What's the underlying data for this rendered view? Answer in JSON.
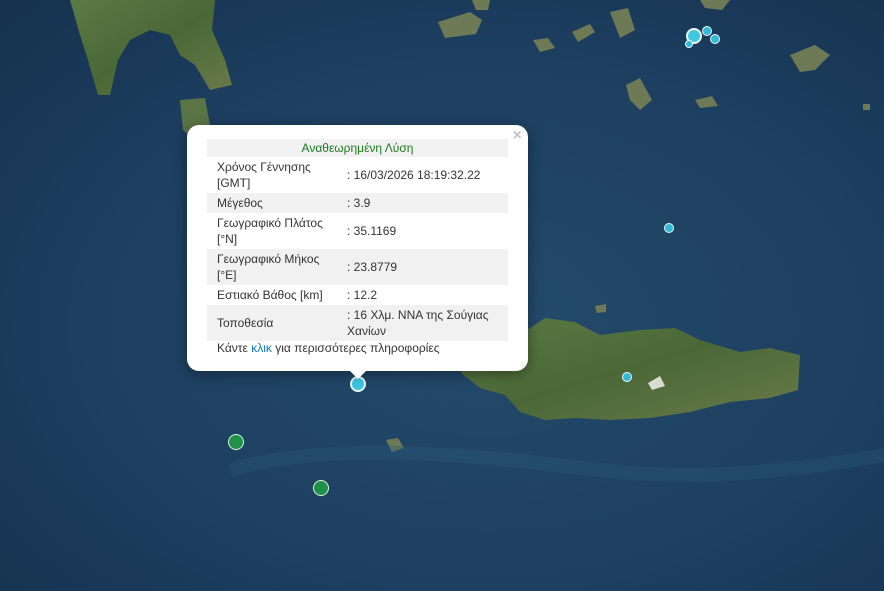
{
  "popup": {
    "close_label": "×",
    "title": "Αναθεωρημένη Λύση",
    "rows": [
      {
        "label": "Χρόνος Γέννησης [GMT]",
        "value": ": 16/03/2026 18:19:32.22"
      },
      {
        "label": "Μέγεθος",
        "value": ": 3.9"
      },
      {
        "label": "Γεωγραφικό Πλάτος [°N]",
        "value": ": 35.1169"
      },
      {
        "label": "Γεωγραφικό Μήκος [°E]",
        "value": ": 23.8779"
      },
      {
        "label": "Εστιακό Βάθος [km]",
        "value": ": 12.2"
      },
      {
        "label": "Τοποθεσία",
        "value": ": 16 Χλμ. ΝΝΑ της Σούγιας Χανίων"
      }
    ],
    "more_before": "Κάντε ",
    "more_link": "κλικ",
    "more_after": " για περισσότερες πληροφορίες"
  },
  "colors": {
    "sea": "#1d3d5c",
    "land": "#4a6a3a",
    "marker_recent": "#35b9d8",
    "marker_older": "#1f8f4a",
    "title_text": "#1e7a1e",
    "link": "#0b7abf"
  }
}
